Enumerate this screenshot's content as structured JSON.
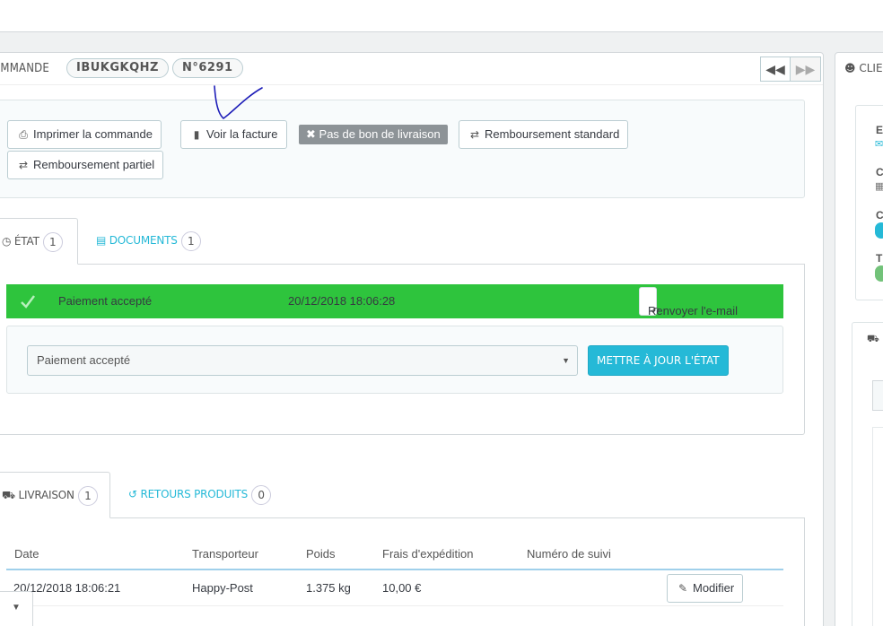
{
  "order": {
    "heading_label": "OMMANDE",
    "reference": "IBUKGKQHZ",
    "number": "N°6291"
  },
  "toolbar": {
    "print_label": "Imprimer la commande",
    "invoice_label": "Voir la facture",
    "no_delivery_label": "Pas de bon de livraison",
    "refund_standard_label": "Remboursement standard",
    "refund_partial_label": "Remboursement partiel"
  },
  "status_tabs": {
    "state_label": "ÉTAT",
    "state_count": "1",
    "documents_label": "DOCUMENTS",
    "documents_count": "1"
  },
  "status": {
    "name": "Paiement accepté",
    "date": "20/12/2018 18:06:28",
    "resend_label": "Renvoyer l'e-mail",
    "select_value": "Paiement accepté",
    "update_label": "METTRE À JOUR L'ÉTAT",
    "row_color": "#2ec43d"
  },
  "shipping_tabs": {
    "delivery_label": "LIVRAISON",
    "delivery_count": "1",
    "returns_label": "RETOURS PRODUITS",
    "returns_count": "0"
  },
  "shipping_table": {
    "headers": [
      "Date",
      "Transporteur",
      "Poids",
      "Frais d'expédition",
      "Numéro de suivi"
    ],
    "rows": [
      {
        "date": "20/12/2018 18:06:21",
        "carrier": "Happy-Post",
        "weight": "1.375 kg",
        "fee": "10,00 €",
        "tracking": "",
        "edit_label": "Modifier"
      }
    ]
  },
  "customer_panel": {
    "heading_label": "CLIE",
    "letters": [
      "E",
      "C",
      "C",
      "T"
    ]
  },
  "colors": {
    "accent": "#25b9d7",
    "success": "#2ec43d"
  }
}
